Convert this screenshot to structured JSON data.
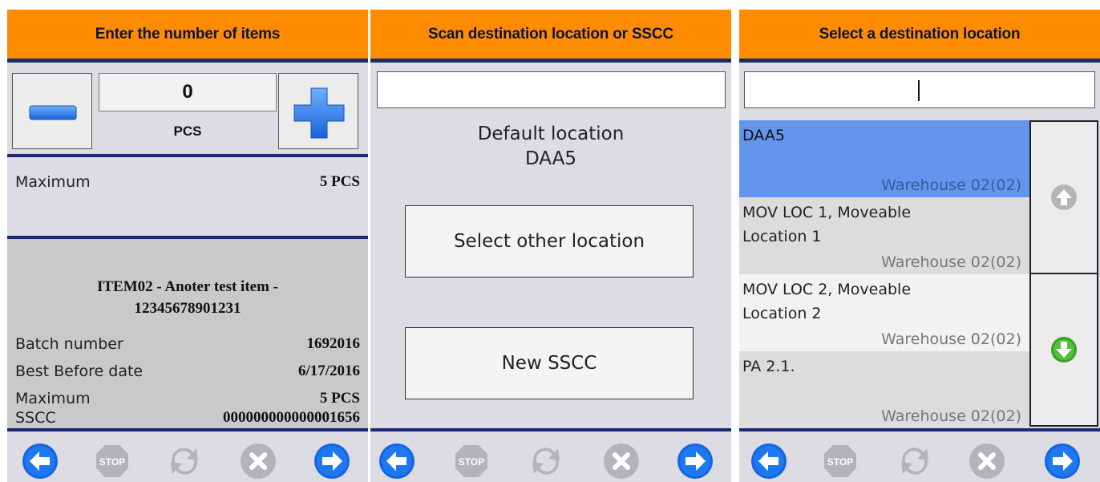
{
  "panel1": {
    "header": "Enter the number of items",
    "quantity": "0",
    "unit": "PCS",
    "maximum_label": "Maximum",
    "maximum_value": "5 PCS",
    "item_title_line1": "ITEM02 - Anoter test item -",
    "item_title_line2": "12345678901231",
    "details": [
      {
        "label": "Batch number",
        "value": "1692016"
      },
      {
        "label": "Best Before date",
        "value": "6/17/2016"
      },
      {
        "label": "Maximum",
        "value": "5 PCS"
      },
      {
        "label": "SSCC",
        "value": "000000000000001656"
      }
    ]
  },
  "panel2": {
    "header": "Scan destination location or SSCC",
    "scan_value": "",
    "default_label": "Default location",
    "default_value": "DAA5",
    "select_other_label": "Select other location",
    "new_sscc_label": "New SSCC"
  },
  "panel3": {
    "header": "Select a destination location",
    "search_value": "",
    "locations": [
      {
        "line1": "DAA5",
        "line2": "",
        "warehouse": "Warehouse 02(02)",
        "selected": true
      },
      {
        "line1": "MOV LOC 1, Moveable",
        "line2": "Location 1",
        "warehouse": "Warehouse 02(02)",
        "selected": false
      },
      {
        "line1": "MOV LOC 2, Moveable",
        "line2": "Location 2",
        "warehouse": "Warehouse 02(02)",
        "selected": false
      },
      {
        "line1": "PA 2.1.",
        "line2": "",
        "warehouse": "Warehouse 02(02)",
        "selected": false
      }
    ]
  },
  "footer": {
    "stop_label": "STOP"
  },
  "colors": {
    "header_bg": "#ff8c00",
    "divider": "#1a2a6e",
    "selected_row": "#6495ed",
    "nav_blue": "#1565e0",
    "disabled_gray": "#b4b4b8",
    "green_arrow": "#3aa02a"
  },
  "icons": [
    "minus-icon",
    "plus-icon",
    "back-arrow-icon",
    "stop-icon",
    "refresh-icon",
    "cancel-icon",
    "forward-arrow-icon",
    "scroll-up-icon",
    "scroll-down-icon"
  ]
}
